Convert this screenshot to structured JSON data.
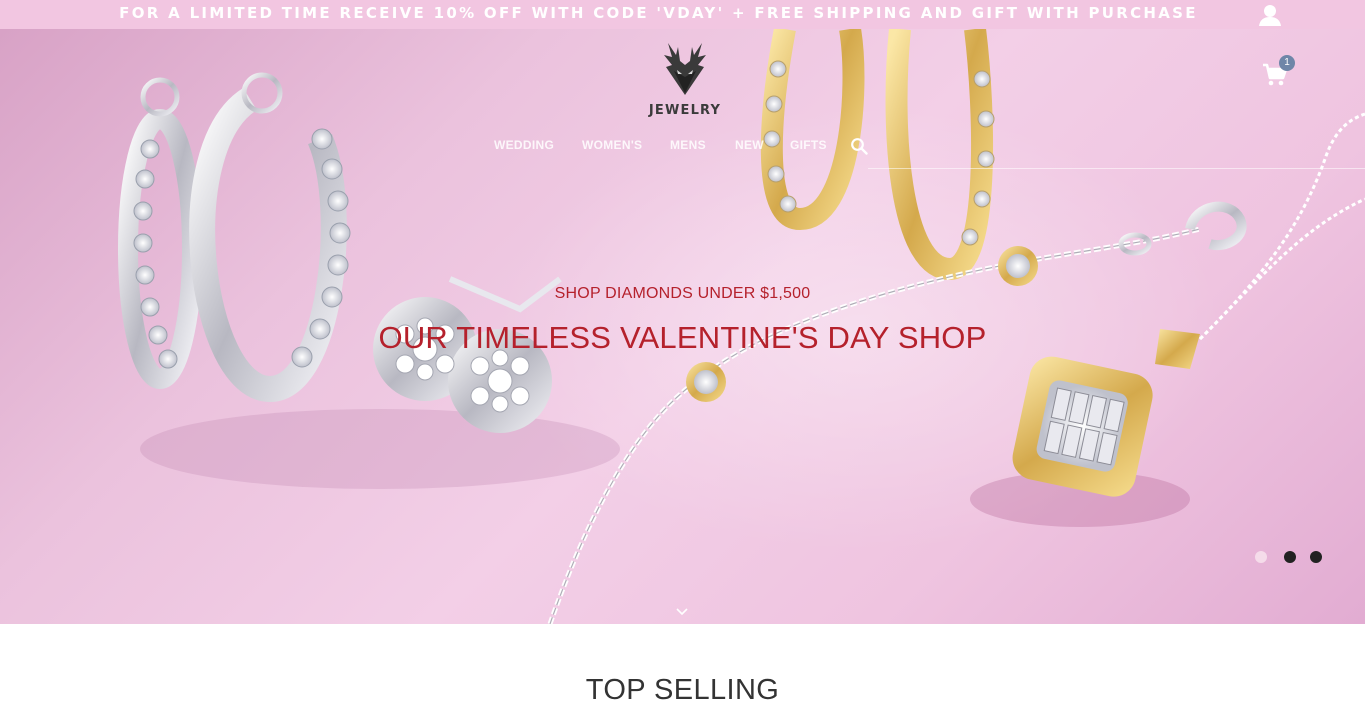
{
  "promo": {
    "text": "FOR A LIMITED TIME RECEIVE 10% OFF WITH CODE 'VDAY' + FREE SHIPPING AND GIFT WITH PURCHASE"
  },
  "header": {
    "logo_text": "JEWELRY",
    "cart_count": "1",
    "nav": [
      {
        "label": "WEDDING"
      },
      {
        "label": "WOMEN'S"
      },
      {
        "label": "MENS"
      },
      {
        "label": "NEW"
      },
      {
        "label": "GIFTS"
      }
    ]
  },
  "hero": {
    "subtitle": "SHOP DIAMONDS UNDER $1,500",
    "title": "OUR TIMELESS VALENTINE'S DAY SHOP",
    "slides_total": 3,
    "active_slide": 1
  },
  "sections": {
    "top_selling": "TOP SELLING"
  },
  "colors": {
    "promo_bg": "#f2c6e1",
    "accent_red": "#b5212c",
    "cart_badge": "#6f86a8"
  },
  "icons": [
    "user-icon",
    "cart-icon",
    "search-icon",
    "chevron-down-icon",
    "deer-logo-icon"
  ]
}
